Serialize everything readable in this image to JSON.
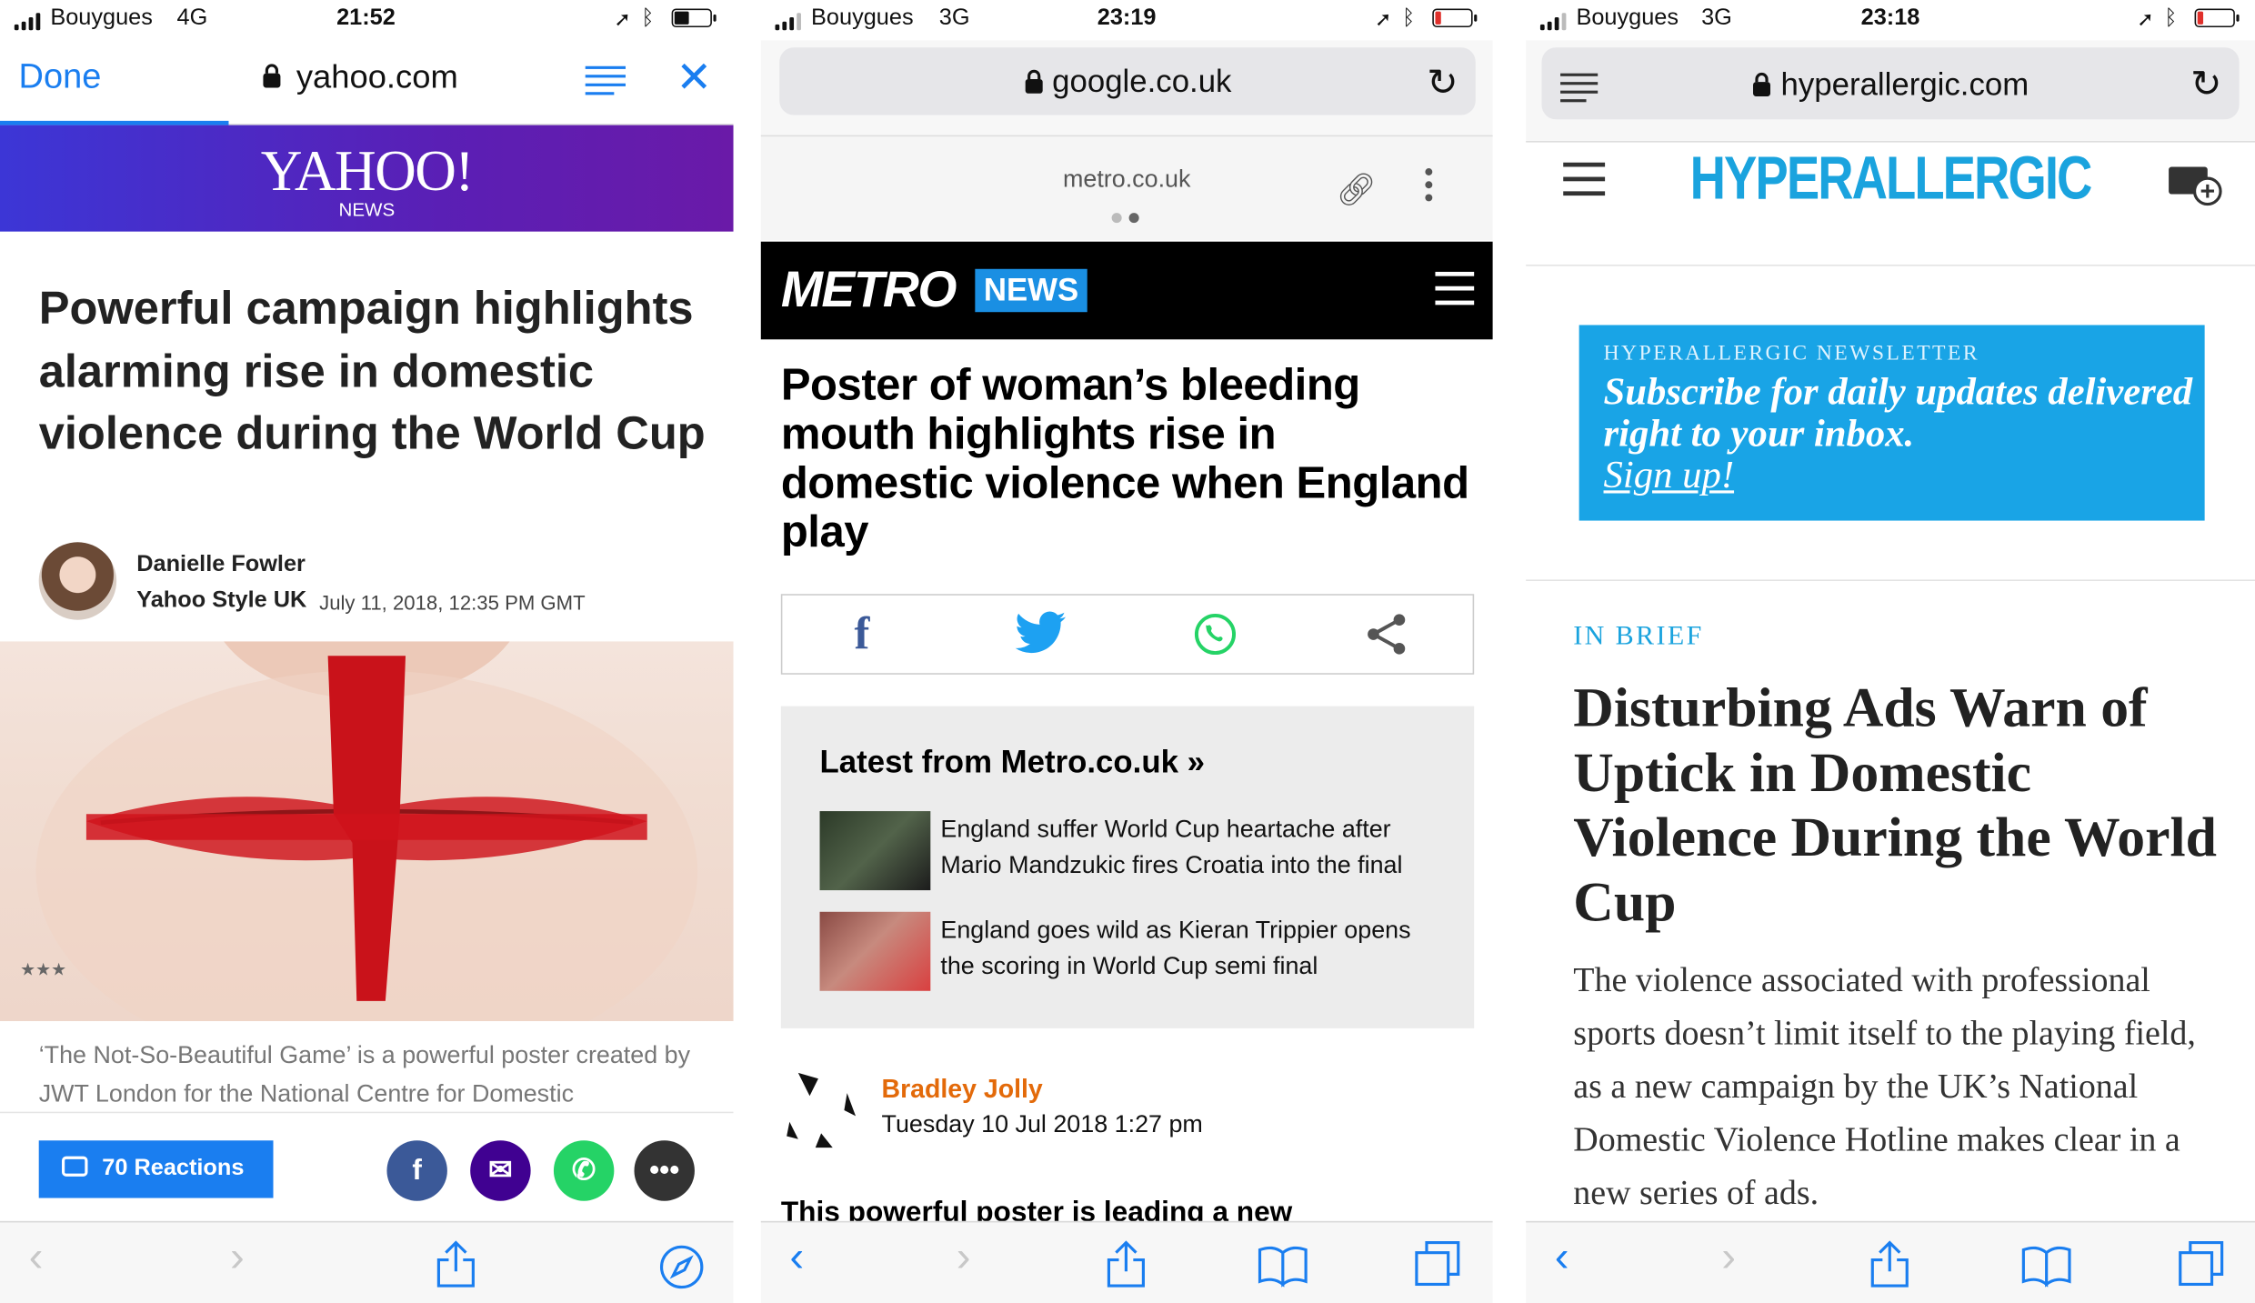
{
  "panels": [
    {
      "status": {
        "carrier": "Bouygues",
        "network": "4G",
        "time": "21:52"
      },
      "urlbar": {
        "done_label": "Done",
        "host": "yahoo.com"
      },
      "brand": {
        "logo": "YAHOO!",
        "sub": "NEWS"
      },
      "article": {
        "headline": "Powerful campaign highlights alarming rise in domestic violence during the World Cup",
        "author": "Danielle Fowler",
        "source": "Yahoo Style UK",
        "date": "July 11, 2018, 12:35 PM GMT",
        "caption": "‘The Not-So-Beautiful Game’ is a powerful poster created by JWT London for the National Centre for Domestic"
      },
      "actions": {
        "reactions_label": "70 Reactions"
      },
      "icons": {
        "reader": "reader-view-icon",
        "close": "close-icon",
        "share": [
          "facebook-icon",
          "email-icon",
          "whatsapp-icon",
          "more-icon"
        ]
      }
    },
    {
      "status": {
        "carrier": "Bouygues",
        "network": "3G",
        "time": "23:19"
      },
      "urlbar": {
        "host": "google.co.uk"
      },
      "amp": {
        "host": "metro.co.uk"
      },
      "brand": {
        "logo": "METRO",
        "section": "NEWS"
      },
      "article": {
        "headline": "Poster of woman’s bleeding mouth highlights rise in domestic violence when England play",
        "latest_title": "Latest from Metro.co.uk  »",
        "latest": [
          {
            "title": "England suffer World Cup heartache after Mario Mandzukic fires Croatia into the final"
          },
          {
            "title": "England goes wild as Kieran Trippier opens the scoring in World Cup semi final"
          }
        ],
        "author": "Bradley Jolly",
        "date": "Tuesday 10 Jul 2018 1:27 pm",
        "body_start": "This powerful poster is leading a new"
      },
      "share_glyphs": {
        "facebook": "f"
      }
    },
    {
      "status": {
        "carrier": "Bouygues",
        "network": "3G",
        "time": "23:18"
      },
      "urlbar": {
        "host": "hyperallergic.com"
      },
      "brand": {
        "logo": "HYPERALLERGIC"
      },
      "newsletter": {
        "label": "HYPERALLERGIC NEWSLETTER",
        "text": "Subscribe for daily updates delivered right to your inbox.",
        "cta": "Sign up!"
      },
      "article": {
        "kicker": "IN BRIEF",
        "headline": "Disturbing Ads Warn of Uptick in Domestic Violence During the World Cup",
        "body": "The violence associated with professional sports doesn’t limit itself to the playing field, as a new campaign by the UK’s National Domestic Violence Hotline makes clear in a new series of ads."
      }
    }
  ],
  "colors": {
    "ios_blue": "#1a7ef0",
    "yahoo_purple": "#5a1fb5",
    "metro_blue": "#1a8fe3",
    "metro_byline_orange": "#e36a0a",
    "hyperallergic_blue": "#1aa3de",
    "facebook": "#3b5998",
    "twitter": "#1da1f2",
    "whatsapp": "#25d366",
    "email_purple": "#400191"
  }
}
